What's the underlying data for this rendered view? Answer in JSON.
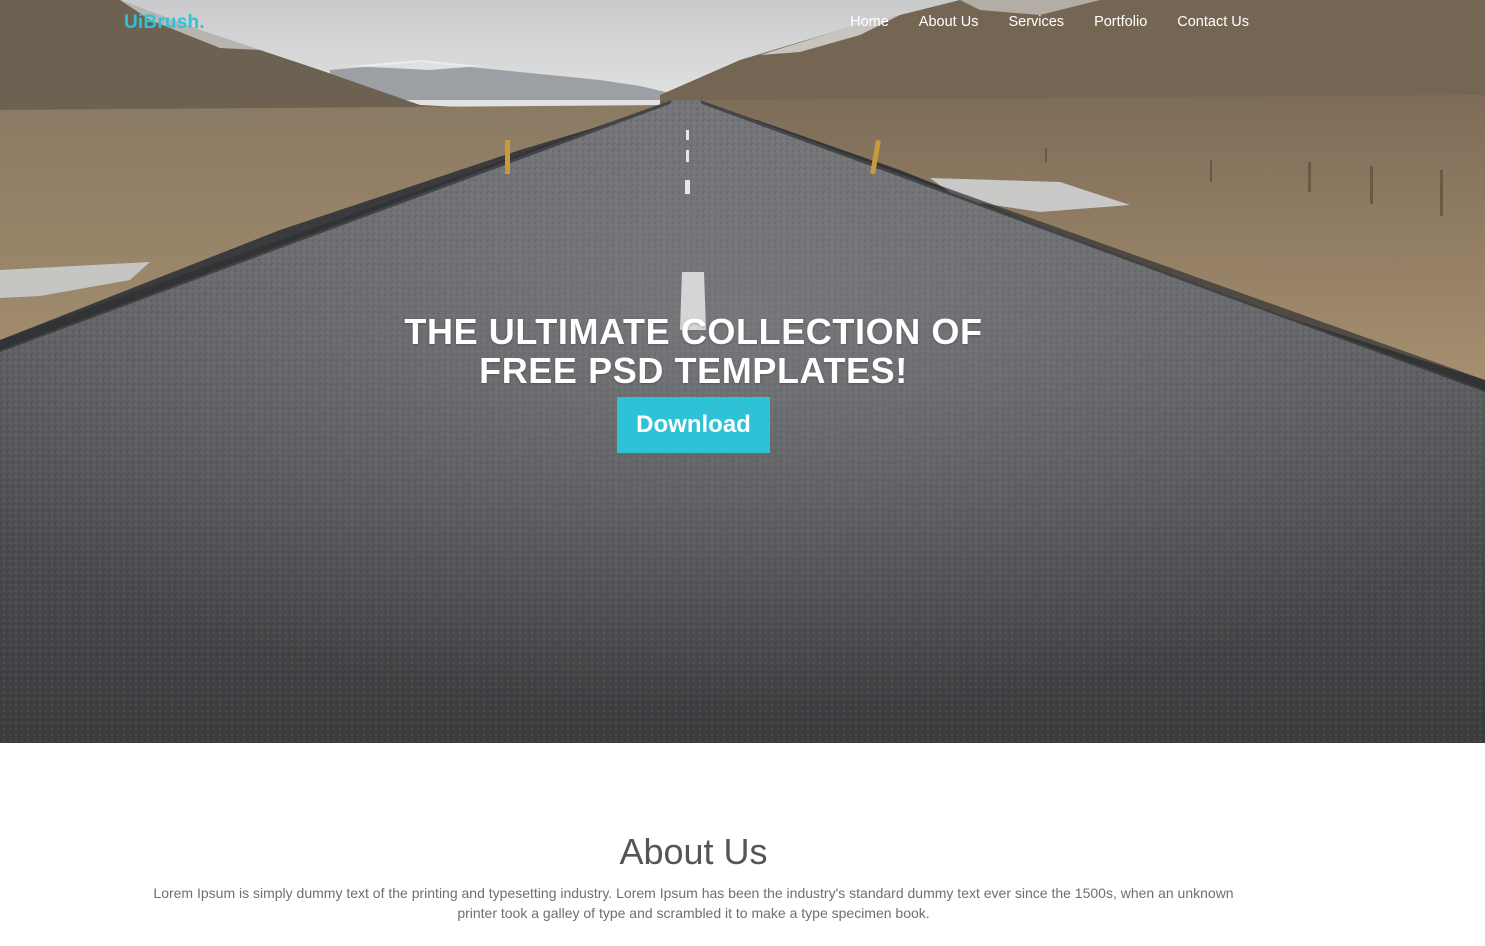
{
  "navbar": {
    "logo_main": "UiBrush",
    "logo_dot": ".",
    "links": [
      "Home",
      "About Us",
      "Services",
      "Portfolio",
      "Contact Us"
    ]
  },
  "hero": {
    "title_line1": "THE ULTIMATE COLLECTION OF",
    "title_line2": "FREE PSD TEMPLATES!",
    "button_label": "Download"
  },
  "about": {
    "heading": "About Us",
    "body": "Lorem Ipsum is simply dummy text of the printing and typesetting industry. Lorem Ipsum has been the industry's standard dummy text ever since the 1500s, when an unknown printer took a galley of type and scrambled it to make a type specimen book."
  },
  "colors": {
    "accent": "#2ec2d6",
    "heading_text": "#555555",
    "body_text": "#6f6f6f"
  },
  "icons": {
    "hero_background": "road-landscape-photo"
  }
}
